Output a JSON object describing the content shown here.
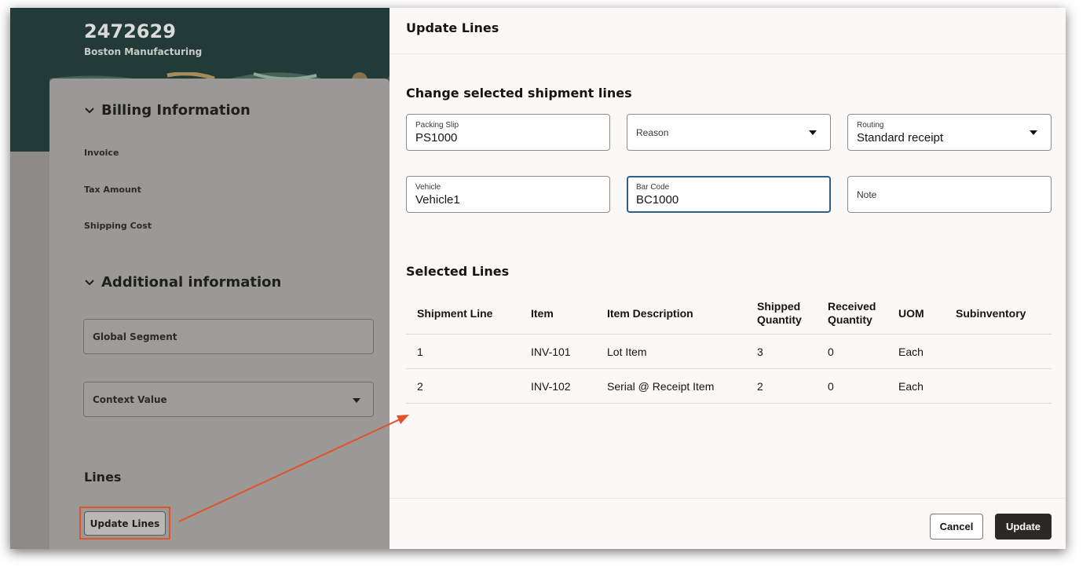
{
  "background_page": {
    "title": "2472629",
    "subtitle": "Boston Manufacturing",
    "billing_section": "Billing Information",
    "billing_labels": [
      "Invoice",
      "Tax Amount",
      "Shipping Cost"
    ],
    "additional_section": "Additional information",
    "global_segment_placeholder": "Global Segment",
    "context_value_placeholder": "Context Value",
    "lines_heading": "Lines",
    "update_lines_button": "Update Lines"
  },
  "drawer": {
    "title": "Update Lines",
    "change_section_title": "Change selected shipment lines",
    "fields": {
      "packing_slip": {
        "label": "Packing Slip",
        "value": "PS1000"
      },
      "reason": {
        "placeholder": "Reason"
      },
      "routing": {
        "label": "Routing",
        "value": "Standard receipt"
      },
      "vehicle": {
        "label": "Vehicle",
        "value": "Vehicle1"
      },
      "bar_code": {
        "label": "Bar Code",
        "value": "BC1000"
      },
      "note": {
        "placeholder": "Note"
      }
    },
    "selected_lines_title": "Selected Lines",
    "table": {
      "headers": [
        "Shipment Line",
        "Item",
        "Item Description",
        "Shipped Quantity",
        "Received Quantity",
        "UOM",
        "Subinventory"
      ],
      "rows": [
        [
          "1",
          "INV-101",
          "Lot Item",
          "3",
          "0",
          "Each",
          ""
        ],
        [
          "2",
          "INV-102",
          "Serial @ Receipt Item",
          "2",
          "0",
          "Each",
          ""
        ]
      ]
    },
    "cancel_label": "Cancel",
    "update_label": "Update"
  },
  "colors": {
    "annotation_red": "#e2522d",
    "header_dark": "#233b38",
    "primary_button": "#2b2927"
  }
}
